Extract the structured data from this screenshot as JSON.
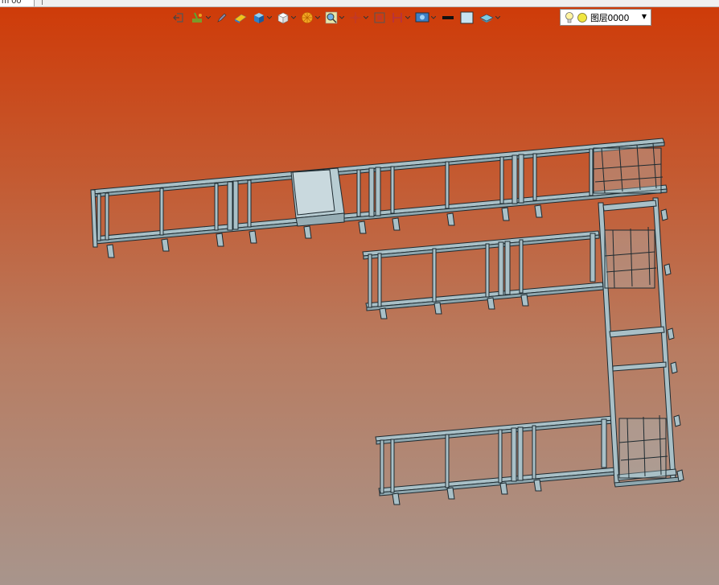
{
  "tab": {
    "title": "m 00"
  },
  "toolbar": {
    "tools": [
      {
        "icon": "exit-icon"
      },
      {
        "icon": "sketch-tool-icon",
        "dropdown": true
      },
      {
        "icon": "pen-icon"
      },
      {
        "icon": "eraser-icon"
      },
      {
        "icon": "box-solid-icon",
        "dropdown": true
      },
      {
        "icon": "view-cube-icon",
        "dropdown": true
      },
      {
        "icon": "render-mode-icon",
        "dropdown": true
      },
      {
        "icon": "zoom-icon",
        "dropdown": true
      },
      {
        "icon": "crosshair-icon",
        "dropdown": true
      },
      {
        "icon": "snap-icon"
      },
      {
        "icon": "section-icon",
        "dropdown": true
      },
      {
        "icon": "display-settings-icon",
        "dropdown": true
      },
      {
        "icon": "line-color-icon"
      },
      {
        "icon": "fill-color-icon"
      },
      {
        "icon": "layer-icon",
        "dropdown": true
      }
    ],
    "layer": {
      "name": "图层0000",
      "bulb_icon": "light-bulb-icon",
      "color_icon": "layer-color-dot"
    }
  },
  "colors": {
    "background_top": "#cf3a07",
    "background_bottom": "#a8958c",
    "frame_fill": "#a9c0c7",
    "frame_stroke": "#1d2a30"
  }
}
